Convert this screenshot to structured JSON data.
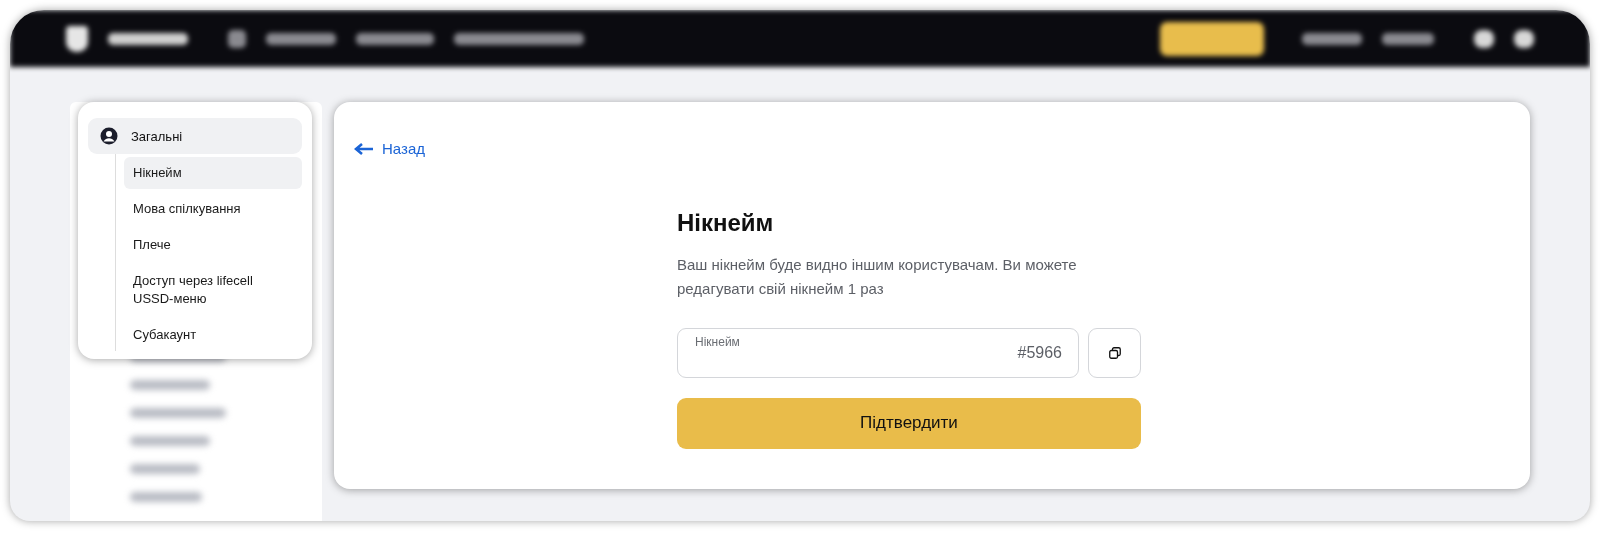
{
  "sidebar": {
    "section": {
      "label": "Загальні",
      "children": [
        {
          "label": "Нікнейм",
          "selected": true
        },
        {
          "label": "Мова спілкування",
          "selected": false
        },
        {
          "label": "Плече",
          "selected": false
        },
        {
          "label": "Доступ через lifecell USSD-меню",
          "selected": false
        },
        {
          "label": "Субакаунт",
          "selected": false
        }
      ]
    }
  },
  "back_link": "Назад",
  "title": "Нікнейм",
  "description": "Ваш нікнейм буде видно іншим користувачам. Ви можете редагувати свій нікнейм 1 раз",
  "nickname_field": {
    "label": "Нікнейм",
    "value": "#5966"
  },
  "submit_button": "Підтвердити"
}
